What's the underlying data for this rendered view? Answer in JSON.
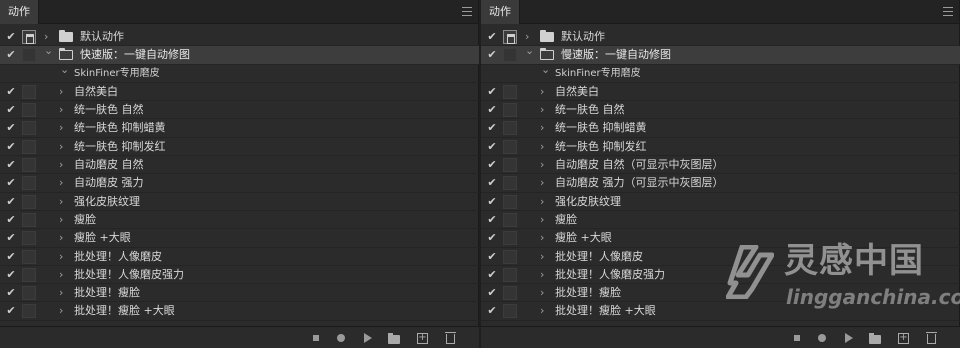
{
  "panels": [
    {
      "tab": "动作",
      "rows": [
        {
          "label": "默认动作",
          "kind": "set-closed",
          "dialog": true
        },
        {
          "label": "快速版：一键自动修图",
          "kind": "set-open",
          "dialog": false
        },
        {
          "label": "SkinFiner专用磨皮",
          "kind": "sub-open",
          "dialog": false
        },
        {
          "label": "自然美白",
          "kind": "action",
          "dialog": false
        },
        {
          "label": "统一肤色 自然",
          "kind": "action",
          "dialog": false
        },
        {
          "label": "统一肤色 抑制蜡黄",
          "kind": "action",
          "dialog": false
        },
        {
          "label": "统一肤色 抑制发红",
          "kind": "action",
          "dialog": false
        },
        {
          "label": "自动磨皮  自然",
          "kind": "action",
          "dialog": false
        },
        {
          "label": "自动磨皮  强力",
          "kind": "action",
          "dialog": false
        },
        {
          "label": "强化皮肤纹理",
          "kind": "action",
          "dialog": false
        },
        {
          "label": "瘦脸",
          "kind": "action",
          "dialog": false
        },
        {
          "label": "瘦脸 +大眼",
          "kind": "action",
          "dialog": false
        },
        {
          "label": "批处理！人像磨皮",
          "kind": "action",
          "dialog": false
        },
        {
          "label": "批处理！人像磨皮强力",
          "kind": "action",
          "dialog": false
        },
        {
          "label": "批处理！瘦脸",
          "kind": "action",
          "dialog": false
        },
        {
          "label": "批处理！瘦脸 +大眼",
          "kind": "action",
          "dialog": false
        }
      ]
    },
    {
      "tab": "动作",
      "rows": [
        {
          "label": "默认动作",
          "kind": "set-closed",
          "dialog": true
        },
        {
          "label": "慢速版：一键自动修图",
          "kind": "set-open",
          "dialog": false
        },
        {
          "label": "SkinFiner专用磨皮",
          "kind": "sub-open",
          "dialog": false
        },
        {
          "label": "自然美白",
          "kind": "action",
          "dialog": false
        },
        {
          "label": "统一肤色 自然",
          "kind": "action",
          "dialog": false
        },
        {
          "label": "统一肤色 抑制蜡黄",
          "kind": "action",
          "dialog": false
        },
        {
          "label": "统一肤色 抑制发红",
          "kind": "action",
          "dialog": false
        },
        {
          "label": "自动磨皮  自然（可显示中灰图层）",
          "kind": "action",
          "dialog": false
        },
        {
          "label": "自动磨皮  强力（可显示中灰图层）",
          "kind": "action",
          "dialog": false
        },
        {
          "label": "强化皮肤纹理",
          "kind": "action",
          "dialog": false
        },
        {
          "label": "瘦脸",
          "kind": "action",
          "dialog": false
        },
        {
          "label": "瘦脸 +大眼",
          "kind": "action",
          "dialog": false
        },
        {
          "label": "批处理！人像磨皮",
          "kind": "action",
          "dialog": false
        },
        {
          "label": "批处理！人像磨皮强力",
          "kind": "action",
          "dialog": false
        },
        {
          "label": "批处理！瘦脸",
          "kind": "action",
          "dialog": false
        },
        {
          "label": "批处理！瘦脸 +大眼",
          "kind": "action",
          "dialog": false
        }
      ]
    }
  ],
  "footer_icons": [
    "stop-icon",
    "record-icon",
    "play-icon",
    "new-set-folder-icon",
    "new-action-icon",
    "trash-icon"
  ],
  "watermark": {
    "cn": "灵感中国",
    "en": "lingganchina.com"
  },
  "colors": {
    "panel_bg": "#2b2b2b",
    "row_selected": "#3d3d3d",
    "tab_active": "#3a3a3a",
    "text": "#d8d8d8"
  }
}
